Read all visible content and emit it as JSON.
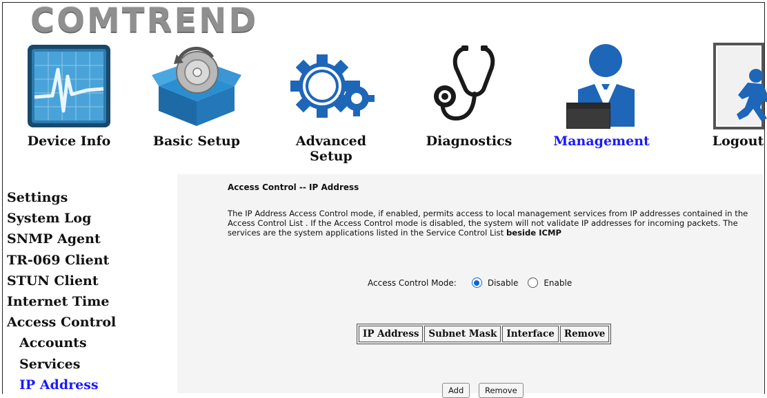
{
  "brand": {
    "logo_text": "COMTREND"
  },
  "nav": [
    {
      "label": "Device Info",
      "icon": "device-info-icon"
    },
    {
      "label": "Basic Setup",
      "icon": "basic-setup-icon"
    },
    {
      "label": "Advanced Setup",
      "icon": "advanced-setup-icon"
    },
    {
      "label": "Diagnostics",
      "icon": "diagnostics-icon"
    },
    {
      "label": "Management",
      "icon": "management-icon",
      "active": true
    },
    {
      "label": "Logout",
      "icon": "logout-icon"
    }
  ],
  "sidebar": {
    "items": [
      {
        "label": "Settings"
      },
      {
        "label": "System Log"
      },
      {
        "label": "SNMP Agent"
      },
      {
        "label": "TR-069 Client"
      },
      {
        "label": "STUN Client"
      },
      {
        "label": "Internet Time"
      },
      {
        "label": "Access Control"
      },
      {
        "label": "Accounts",
        "sub": true
      },
      {
        "label": "Services",
        "sub": true
      },
      {
        "label": "IP Address",
        "sub": true,
        "active": true
      }
    ]
  },
  "main": {
    "title": "Access Control -- IP Address",
    "description": "The IP Address Access Control mode, if enabled, permits access to local management services from IP addresses contained in the Access Control List . If the Access Control mode is disabled, the system will not validate IP addresses for incoming packets. The services are the system applications listed in the Service Control List",
    "description_bold": "beside ICMP",
    "mode_label": "Access Control Mode:",
    "mode_options": [
      {
        "label": "Disable",
        "checked": true
      },
      {
        "label": "Enable",
        "checked": false
      }
    ],
    "table_headers": [
      "IP Address",
      "Subnet Mask",
      "Interface",
      "Remove"
    ],
    "buttons": {
      "add": "Add",
      "remove": "Remove"
    }
  },
  "colors": {
    "active_link": "#1a1aff",
    "icon_blue": "#1e66b8",
    "radio_accent": "#0a66d6"
  }
}
